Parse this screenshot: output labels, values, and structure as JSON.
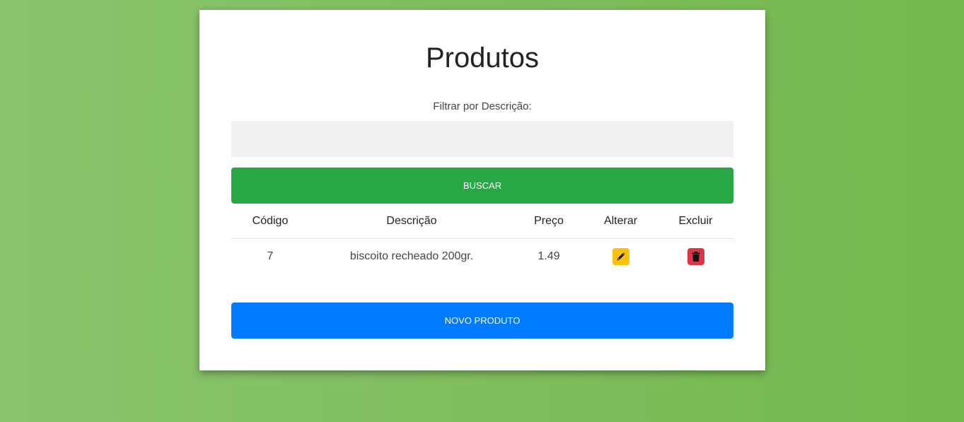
{
  "page": {
    "title": "Produtos",
    "filter_label": "Filtrar por Descrição:",
    "filter_value": "",
    "filter_placeholder": "",
    "search_button": "BUSCAR",
    "new_button": "NOVO PRODUTO"
  },
  "table": {
    "headers": {
      "codigo": "Código",
      "descricao": "Descrição",
      "preco": "Preço",
      "alterar": "Alterar",
      "excluir": "Excluir"
    },
    "rows": [
      {
        "codigo": "7",
        "descricao": "biscoito recheado 200gr.",
        "preco": "1.49"
      }
    ]
  },
  "icons": {
    "edit": "pencil-icon",
    "delete": "trash-icon"
  },
  "colors": {
    "background": "#7fbd5e",
    "search_button": "#28a745",
    "new_button": "#007bff",
    "edit_button": "#ffc107",
    "delete_button": "#dc3545"
  }
}
